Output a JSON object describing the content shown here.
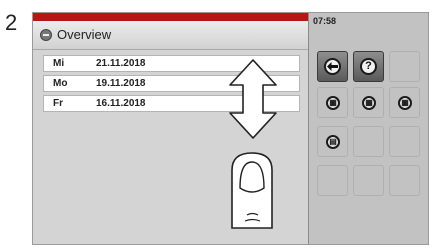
{
  "step": {
    "number": "2"
  },
  "header": {
    "title": "Overview"
  },
  "entries": [
    {
      "day": "Mi",
      "date": "21.11.2018"
    },
    {
      "day": "Mo",
      "date": "19.11.2018"
    },
    {
      "day": "Fr",
      "date": "16.11.2018"
    }
  ],
  "status": {
    "time": "07:58"
  },
  "buttons": {
    "back": {
      "icon": "back-arrow-icon"
    },
    "help": {
      "icon": "help-icon",
      "label": "?"
    }
  },
  "colors": {
    "accent_red": "#b81515",
    "panel_gray": "#d4d4d4",
    "side_gray": "#c2c2c2"
  },
  "gesture": {
    "icon": "swipe-vertical-hand-icon"
  }
}
